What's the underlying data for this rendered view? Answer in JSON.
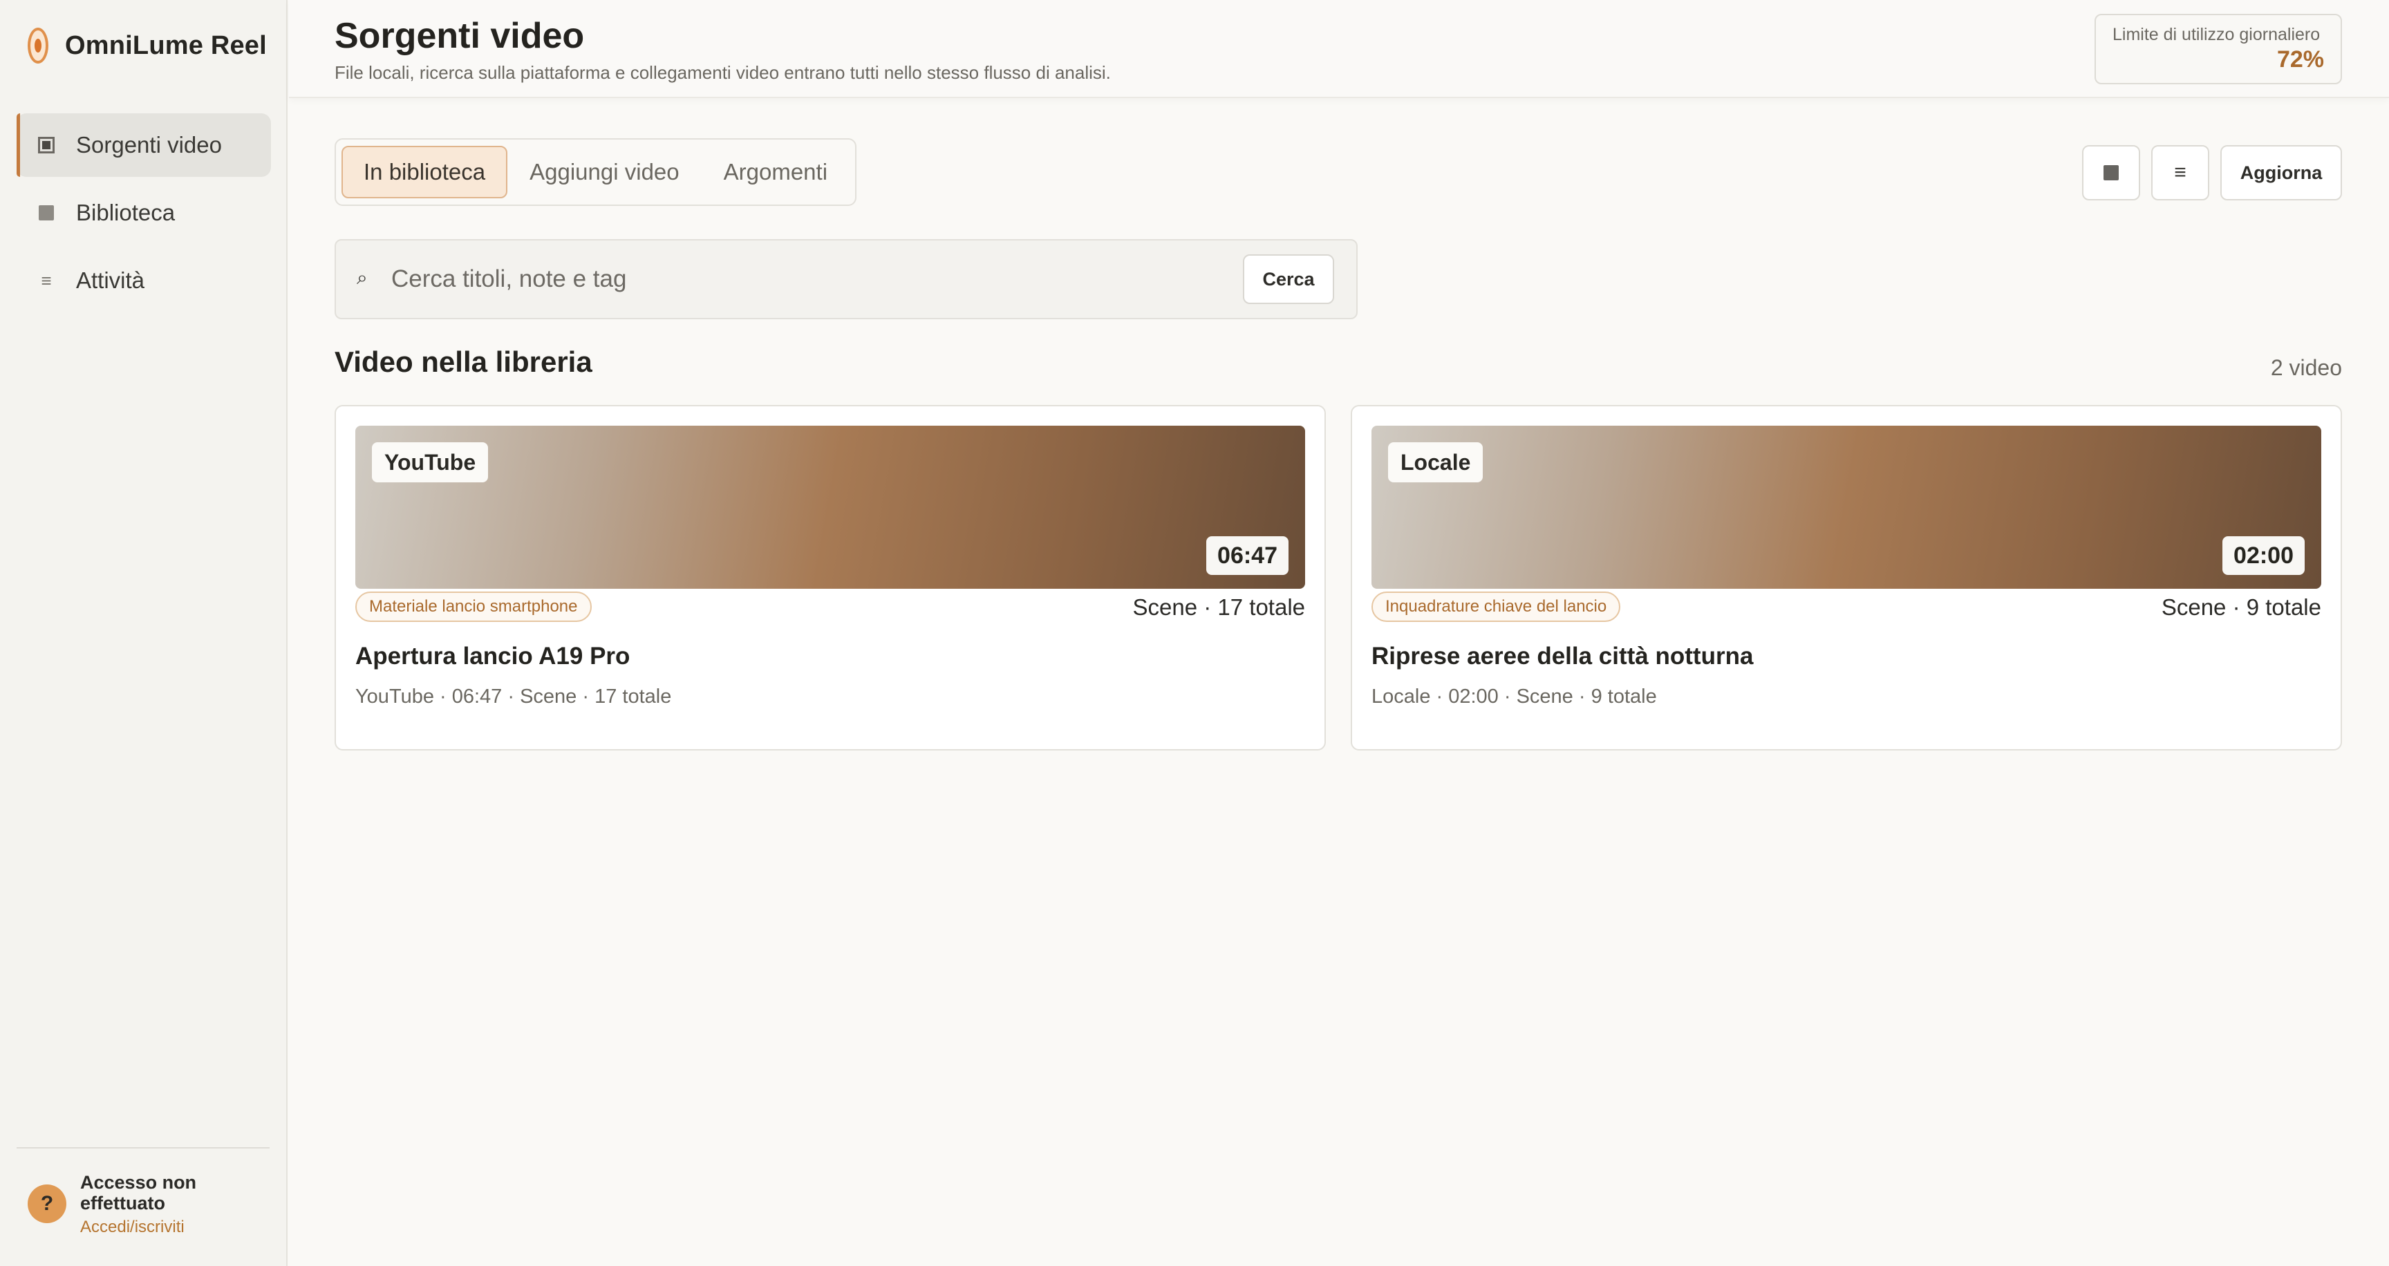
{
  "brand": {
    "name": "OmniLume Reel",
    "logo_icon": "flame-logo-icon",
    "accent": "#c47a3d"
  },
  "sidebar": {
    "items": [
      {
        "label": "Sorgenti video",
        "icon": "framed-square-icon",
        "active": true
      },
      {
        "label": "Biblioteca",
        "icon": "square-icon",
        "active": false
      },
      {
        "label": "Attività",
        "icon": "list-icon",
        "active": false
      }
    ]
  },
  "account": {
    "avatar": "?",
    "status": "Accesso non effettuato",
    "link": "Accedi/iscriviti"
  },
  "header": {
    "title": "Sorgenti video",
    "subtitle": "File locali, ricerca sulla piattaforma e collegamenti video entrano tutti nello stesso flusso di analisi.",
    "usage_label": "Limite di utilizzo giornaliero",
    "usage_value": "72%"
  },
  "tabs": [
    {
      "label": "In biblioteca",
      "active": true
    },
    {
      "label": "Aggiungi video",
      "active": false
    },
    {
      "label": "Argomenti",
      "active": false
    }
  ],
  "toolbar": {
    "grid_icon": "grid-view-icon",
    "list_icon": "list-view-icon",
    "list_glyph": "≡",
    "refresh_label": "Aggiorna"
  },
  "search": {
    "icon_glyph": "⌕",
    "placeholder": "Cerca titoli, note e tag",
    "value": "",
    "button_label": "Cerca"
  },
  "library": {
    "title": "Video nella libreria",
    "count": "2 video",
    "videos": [
      {
        "source": "YouTube",
        "duration": "06:47",
        "tag": "Materiale lancio smartphone",
        "scenes": "Scene · 17 totale",
        "title": "Apertura lancio A19 Pro",
        "meta": "YouTube · 06:47 · Scene · 17 totale"
      },
      {
        "source": "Locale",
        "duration": "02:00",
        "tag": "Inquadrature chiave del lancio",
        "scenes": "Scene · 9 totale",
        "title": "Riprese aeree della città notturna",
        "meta": "Locale · 02:00 · Scene · 9 totale"
      }
    ]
  }
}
